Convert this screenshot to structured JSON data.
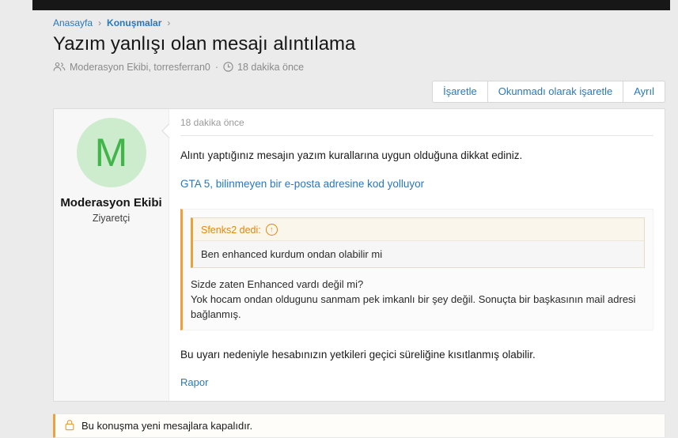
{
  "colors": {
    "accent_blue": "#2878bd",
    "accent_orange": "#f0a03a",
    "quote_author_orange": "#e0870f",
    "avatar_green": "#41b549",
    "avatar_green_bg": "#cdeccd",
    "topbar_black": "#171717",
    "page_bg": "#ebebeb"
  },
  "icons": {
    "chevron": "›",
    "dot": "·",
    "arrow_up": "↑"
  },
  "breadcrumb": {
    "home": "Anasayfa",
    "section": "Konuşmalar"
  },
  "thread": {
    "title": "Yazım yanlışı olan mesajı alıntılama",
    "participants": "Moderasyon Ekibi, torresferran0",
    "time": "18 dakika önce"
  },
  "actions": {
    "mark": "İşaretle",
    "mark_unread": "Okunmadı olarak işaretle",
    "leave": "Ayrıl"
  },
  "message": {
    "author": "Moderasyon Ekibi",
    "author_initial": "M",
    "role": "Ziyaretçi",
    "time": "18 dakika önce",
    "body": "Alıntı yaptığınız mesajın yazım kurallarına uygun olduğuna dikkat ediniz.",
    "link": "GTA 5, bilinmeyen bir e-posta adresine kod yolluyor",
    "quote": {
      "attribution": "Sfenks2 dedi:",
      "quoted_text": "Ben enhanced kurdum ondan olabilir mi",
      "reply_line1": "Sizde zaten Enhanced vardı değil mi?",
      "reply_line2": "Yok hocam ondan oldugunu sanmam pek imkanlı bir şey değil. Sonuçta bir başkasının mail adresi bağlanmış."
    },
    "warning": "Bu uyarı nedeniyle hesabınızın yetkileri geçici süreliğine kısıtlanmış olabilir.",
    "report": "Rapor"
  },
  "notice": {
    "text": "Bu konuşma yeni mesajlara kapalıdır."
  }
}
